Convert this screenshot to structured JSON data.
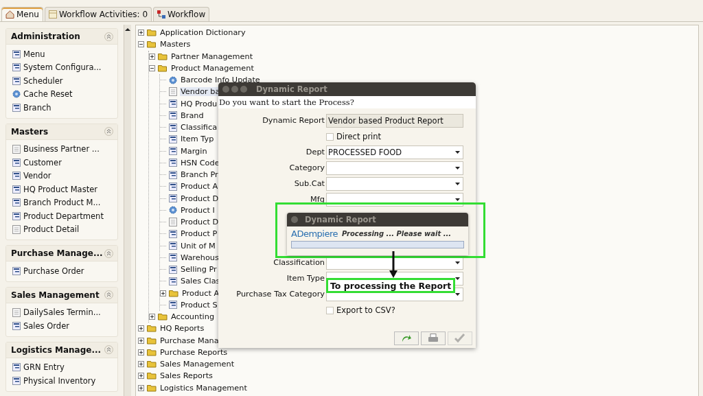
{
  "tabs": [
    {
      "label": "Menu",
      "selected": true,
      "kind": "home"
    },
    {
      "label": "Workflow Activities: 0",
      "selected": false,
      "kind": "activities"
    },
    {
      "label": "Workflow",
      "selected": false,
      "kind": "workflow"
    }
  ],
  "sidebar": {
    "sections": [
      {
        "title": "Administration",
        "items": [
          {
            "label": "Menu",
            "kind": "window"
          },
          {
            "label": "System Configura...",
            "kind": "window"
          },
          {
            "label": "Scheduler",
            "kind": "window"
          },
          {
            "label": "Cache Reset",
            "kind": "process"
          },
          {
            "label": "Branch",
            "kind": "window"
          }
        ]
      },
      {
        "title": "Masters",
        "items": [
          {
            "label": "Business Partner ...",
            "kind": "report"
          },
          {
            "label": "Customer",
            "kind": "window"
          },
          {
            "label": "Vendor",
            "kind": "window"
          },
          {
            "label": "HQ Product Master",
            "kind": "window"
          },
          {
            "label": "Branch Product M...",
            "kind": "window"
          },
          {
            "label": "Product Department",
            "kind": "window"
          },
          {
            "label": "Product Detail",
            "kind": "report"
          }
        ]
      },
      {
        "title": "Purchase Manage...",
        "items": [
          {
            "label": "Purchase Order",
            "kind": "window"
          }
        ]
      },
      {
        "title": "Sales Management",
        "items": [
          {
            "label": "DailySales Termin...",
            "kind": "report"
          },
          {
            "label": "Sales Order",
            "kind": "window"
          }
        ]
      },
      {
        "title": "Logistics Manage...",
        "items": [
          {
            "label": "GRN Entry",
            "kind": "window"
          },
          {
            "label": "Physical Inventory",
            "kind": "window"
          }
        ]
      }
    ]
  },
  "tree": [
    {
      "label": "Application Dictionary",
      "kind": "folder",
      "expanded": false
    },
    {
      "label": "Masters",
      "kind": "folder",
      "expanded": true,
      "children": [
        {
          "label": "Partner Management",
          "kind": "folder",
          "expanded": false
        },
        {
          "label": "Product Management",
          "kind": "folder",
          "expanded": true,
          "children": [
            {
              "label": "Barcode Info Update",
              "kind": "process",
              "selected": false
            },
            {
              "label": "Vendor ba",
              "kind": "report",
              "selected": true
            },
            {
              "label": "HQ Produ",
              "kind": "window",
              "selected": false
            },
            {
              "label": "Brand",
              "kind": "window",
              "selected": false
            },
            {
              "label": "Classifica",
              "kind": "window",
              "selected": false
            },
            {
              "label": "Item Typ",
              "kind": "window",
              "selected": false
            },
            {
              "label": "Margin",
              "kind": "window",
              "selected": false
            },
            {
              "label": "HSN Code",
              "kind": "window",
              "selected": false
            },
            {
              "label": "Branch Pr",
              "kind": "window",
              "selected": false
            },
            {
              "label": "Product A",
              "kind": "window",
              "selected": false
            },
            {
              "label": "Product D",
              "kind": "window",
              "selected": false
            },
            {
              "label": "Product I",
              "kind": "process",
              "selected": false
            },
            {
              "label": "Product D",
              "kind": "report",
              "selected": false
            },
            {
              "label": "Product P",
              "kind": "window",
              "selected": false
            },
            {
              "label": "Unit of M",
              "kind": "window",
              "selected": false
            },
            {
              "label": "Warehous",
              "kind": "window",
              "selected": false
            },
            {
              "label": "Selling Pr",
              "kind": "window",
              "selected": false
            },
            {
              "label": "Sales Clas",
              "kind": "window",
              "selected": false
            },
            {
              "label": "Product A",
              "kind": "folder",
              "expanded": false
            },
            {
              "label": "Product S",
              "kind": "window",
              "selected": false
            }
          ]
        },
        {
          "label": "Accounting",
          "kind": "folder",
          "expanded": false
        }
      ]
    },
    {
      "label": "HQ Reports",
      "kind": "folder",
      "expanded": false
    },
    {
      "label": "Purchase Mana",
      "kind": "folder",
      "expanded": false
    },
    {
      "label": "Purchase Reports",
      "kind": "folder",
      "expanded": false
    },
    {
      "label": "Sales Management",
      "kind": "folder",
      "expanded": false
    },
    {
      "label": "Sales Reports",
      "kind": "folder",
      "expanded": false
    },
    {
      "label": "Logistics Management",
      "kind": "folder",
      "expanded": false
    }
  ],
  "dialog": {
    "title": "Dynamic Report",
    "question": "Do you want to start the Process?",
    "fields": [
      {
        "kind": "readonly",
        "label": "Dynamic Report",
        "value": "Vendor based Product Report"
      },
      {
        "kind": "checkbox",
        "label": "Direct print",
        "checked": false
      },
      {
        "kind": "combo",
        "label": "Dept",
        "value": "PROCESSED FOOD"
      },
      {
        "kind": "combo",
        "label": "Category"
      },
      {
        "kind": "combo",
        "label": "Sub.Cat"
      },
      {
        "kind": "combo",
        "label": "Mfg"
      },
      {
        "kind": "hidden"
      },
      {
        "kind": "hidden"
      },
      {
        "kind": "hidden"
      },
      {
        "kind": "combo",
        "label": "Classification"
      },
      {
        "kind": "combo",
        "label": "Item Type"
      },
      {
        "kind": "combo",
        "label": "Purchase Tax Category"
      },
      {
        "kind": "checkbox",
        "label": "Export to CSV?",
        "checked": false
      }
    ],
    "buttons": [
      {
        "kind": "redo",
        "disabled": false
      },
      {
        "kind": "print",
        "disabled": false
      },
      {
        "kind": "ok",
        "disabled": true
      }
    ]
  },
  "progress": {
    "title": "Dynamic Report",
    "logo": "ADempiere",
    "message": "Processing ... Please wait ...",
    "level": 1
  },
  "annotation": {
    "label": "To processing the Report"
  }
}
